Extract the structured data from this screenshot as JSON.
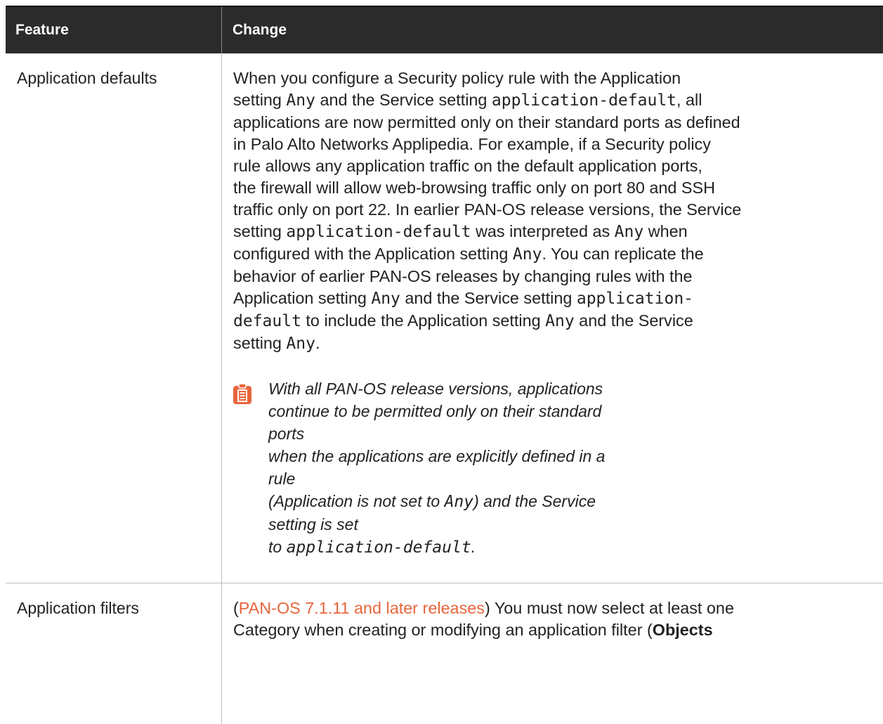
{
  "table": {
    "headers": [
      "Feature",
      "Change"
    ],
    "row1": {
      "feature": "Application defaults",
      "p": [
        "When you configure a Security policy rule with the Application",
        "setting ",
        "Any",
        " and the Service setting ",
        "application-default",
        ", all",
        "applications are now permitted only on their standard ports as defined",
        "in Palo Alto Networks Applipedia. For example, if a Security policy",
        "rule allows any application traffic on the default application ports,",
        "the firewall will allow web-browsing traffic only on port 80 and SSH",
        "traffic only on port 22. In earlier PAN-OS release versions, the Service",
        "setting ",
        "application-default",
        " was interpreted as ",
        "Any",
        " when",
        "configured with the Application setting ",
        "Any",
        ". You can replicate the",
        "behavior of earlier PAN-OS releases by changing rules with the",
        "Application setting ",
        "Any",
        " and the Service setting ",
        "application-",
        "default",
        " to include the Application setting ",
        "Any",
        " and the Service",
        "setting ",
        "Any",
        "."
      ],
      "note": {
        "l1": "With all PAN-OS release versions, applications",
        "l2": "continue to be permitted only on their standard ports",
        "l3": "when the applications are explicitly defined in a rule",
        "l4a": "(Application is not set to ",
        "l4b": "Any",
        "l4c": ") and the Service setting is set",
        "l5a": "to ",
        "l5b": "application-default",
        "l5c": "."
      }
    },
    "row2": {
      "feature": "Application filters",
      "link": "PAN-OS 7.1.11 and later releases",
      "t1a": "(",
      "t1b": ") You must now select at least one",
      "t2a": "Category when creating or modifying an application filter (",
      "t2b": "Objects"
    }
  },
  "colors": {
    "header_bg": "#2b2b2b",
    "link": "#e8663d",
    "note_icon": "#e8663d"
  }
}
